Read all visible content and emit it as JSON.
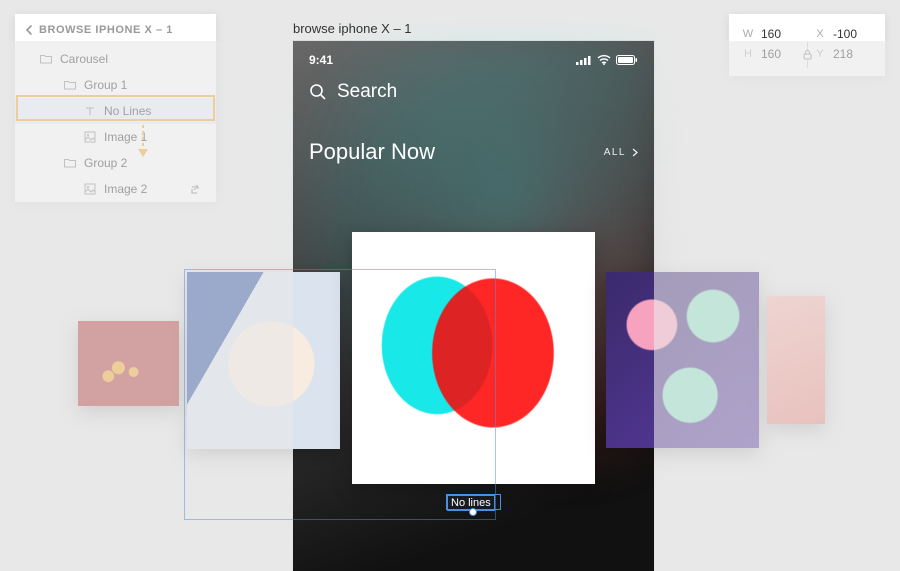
{
  "layers": {
    "header": "BROWSE IPHONE X – 1",
    "items": [
      {
        "label": "Carousel",
        "type": "folder",
        "indent": 24
      },
      {
        "label": "Group 1",
        "type": "folder",
        "indent": 48
      },
      {
        "label": "No Lines",
        "type": "text",
        "indent": 68,
        "selected": true
      },
      {
        "label": "Image 1",
        "type": "image",
        "indent": 68
      },
      {
        "label": "Group 2",
        "type": "folder",
        "indent": 48
      },
      {
        "label": "Image 2",
        "type": "image",
        "indent": 68,
        "action": true
      }
    ]
  },
  "props": {
    "W": "160",
    "H": "160",
    "X": "-100",
    "Y": "218"
  },
  "canvas": {
    "title": "browse iphone X – 1",
    "time": "9:41",
    "search": "Search",
    "popular": "Popular Now",
    "all": "ALL",
    "selection_label": "No lines"
  }
}
